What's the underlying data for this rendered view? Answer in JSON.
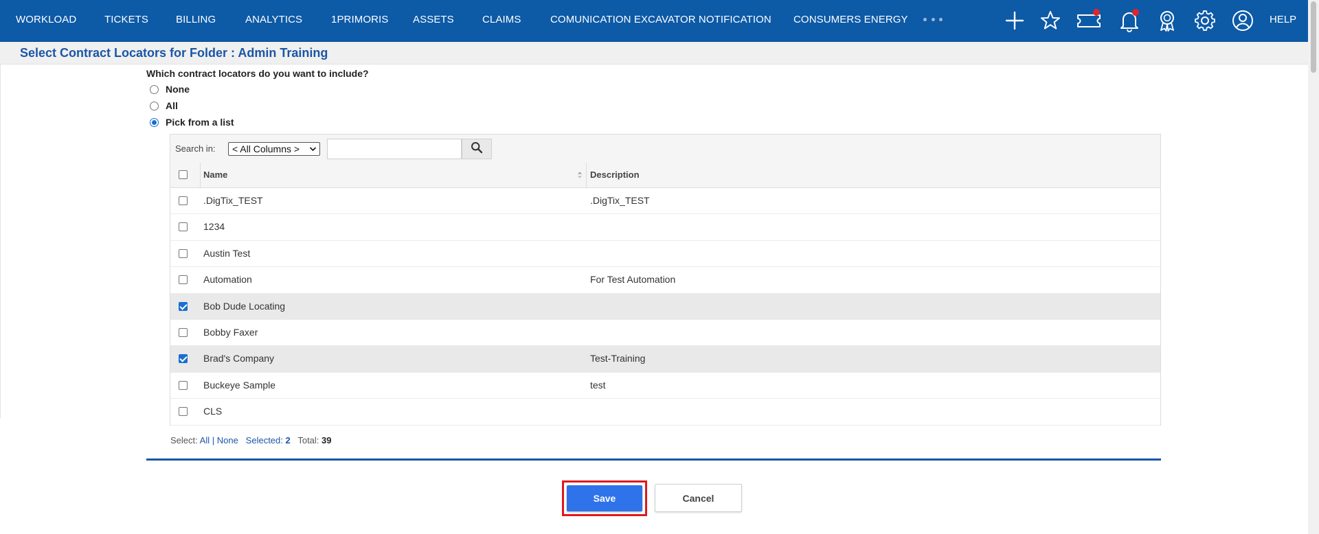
{
  "nav": {
    "items": [
      "WORKLOAD",
      "TICKETS",
      "BILLING",
      "ANALYTICS",
      "1PRIMORIS",
      "ASSETS",
      "CLAIMS",
      "COMUNICATION EXCAVATOR NOTIFICATION",
      "CONSUMERS ENERGY"
    ],
    "more_icon": "more-dots-icon",
    "icons": [
      "plus-icon",
      "star-icon",
      "ticket-icon",
      "bell-icon",
      "award-icon",
      "gear-icon",
      "user-icon"
    ],
    "help": "HELP",
    "colors": {
      "bar": "#0d5aa7",
      "badge": "#e0252b"
    }
  },
  "page": {
    "title": "Select Contract Locators for Folder : Admin Training"
  },
  "question": {
    "label": "Which contract locators do you want to include?",
    "options": [
      "None",
      "All",
      "Pick from a list"
    ],
    "selected": "Pick from a list"
  },
  "search": {
    "label": "Search in:",
    "column_select": "< All Columns >",
    "value": "",
    "button_icon": "search-icon"
  },
  "table": {
    "columns": [
      "Name",
      "Description"
    ],
    "rows": [
      {
        "name": ".DigTix_TEST",
        "description": ".DigTix_TEST",
        "checked": false
      },
      {
        "name": "1234",
        "description": "",
        "checked": false
      },
      {
        "name": "Austin Test",
        "description": "",
        "checked": false
      },
      {
        "name": "Automation",
        "description": "For Test Automation",
        "checked": false
      },
      {
        "name": "Bob Dude Locating",
        "description": "",
        "checked": true
      },
      {
        "name": "Bobby Faxer",
        "description": "",
        "checked": false
      },
      {
        "name": "Brad's Company",
        "description": "Test-Training",
        "checked": true
      },
      {
        "name": "Buckeye Sample",
        "description": "test",
        "checked": false
      },
      {
        "name": "CLS",
        "description": "",
        "checked": false
      }
    ]
  },
  "footer": {
    "select_label": "Select:",
    "all_link": "All",
    "sep": "|",
    "none_link": "None",
    "selected_label": "Selected:",
    "selected_count": "2",
    "total_label": "Total:",
    "total_count": "39"
  },
  "buttons": {
    "save": "Save",
    "cancel": "Cancel"
  }
}
